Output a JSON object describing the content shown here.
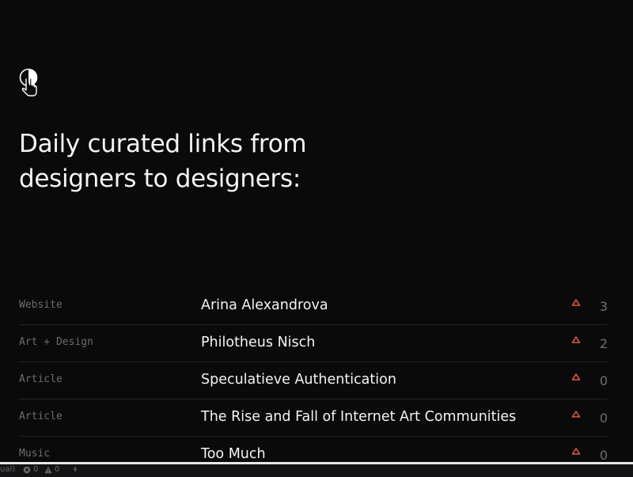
{
  "header": {
    "logo_icon": "half-circle-pointer-logo-icon",
    "tagline_line1": "Daily curated links from",
    "tagline_line2": "designers to designers:"
  },
  "feed": {
    "accent_color": "#e0573a",
    "items": [
      {
        "category": "Website",
        "title": "Arina Alexandrova",
        "votes": "3"
      },
      {
        "category": "Art + Design",
        "title": "Philotheus Nisch",
        "votes": "2"
      },
      {
        "category": "Article",
        "title": "Speculatieve Authentication",
        "votes": "0"
      },
      {
        "category": "Article",
        "title": "The Rise and Fall of Internet Art Communities",
        "votes": "0"
      },
      {
        "category": "Music",
        "title": "Too Much",
        "votes": "0"
      }
    ]
  },
  "statusbar": {
    "left_text": "ual)",
    "errors": "0",
    "warnings": "0",
    "icons": [
      "error-circle-icon",
      "warning-triangle-icon",
      "lightning-icon"
    ]
  }
}
